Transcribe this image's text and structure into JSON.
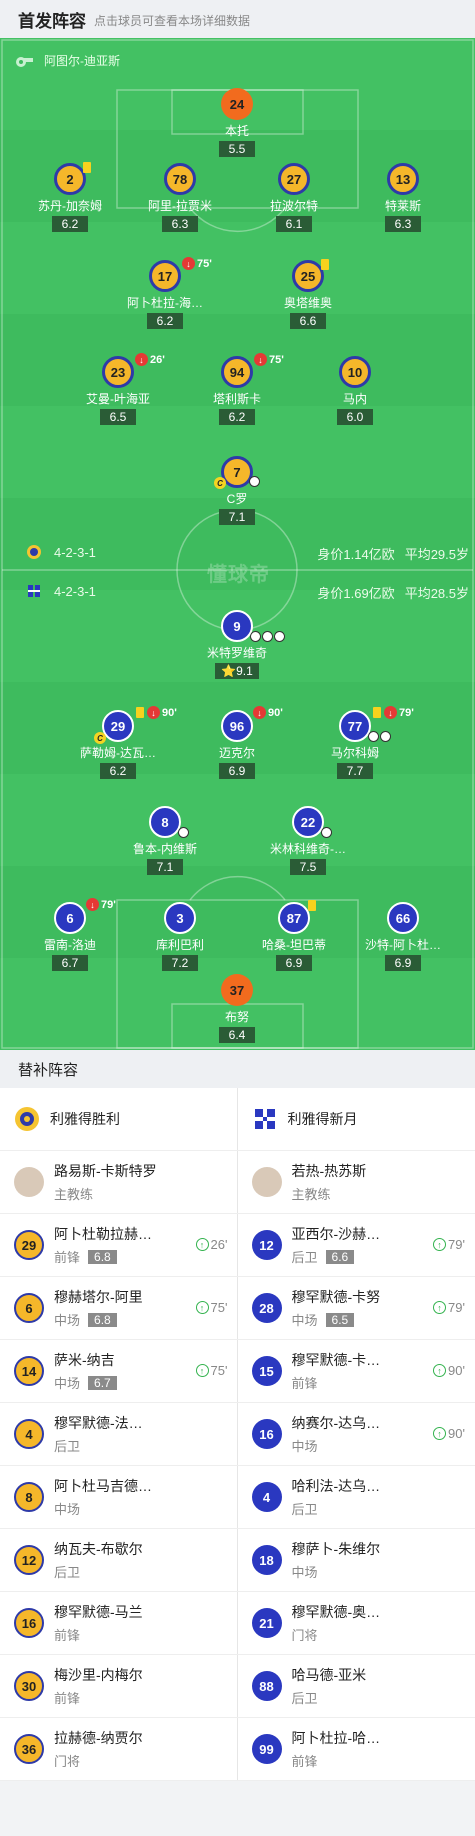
{
  "header": {
    "title": "首发阵容",
    "hint": "点击球员可查看本场详细数据"
  },
  "pitch": {
    "referee": "阿图尔-迪亚斯",
    "home": {
      "formation": "4-2-3-1",
      "value": "身价1.14亿欧",
      "age": "平均29.5岁"
    },
    "away": {
      "formation": "4-2-3-1",
      "value": "身价1.69亿欧",
      "age": "平均28.5岁"
    },
    "watermark": "懂球帝"
  },
  "home_players": [
    {
      "num": "24",
      "name": "本托",
      "rating": "5.5"
    },
    {
      "num": "2",
      "name": "苏丹-加奈姆",
      "rating": "6.2"
    },
    {
      "num": "78",
      "name": "阿里-拉贾米",
      "rating": "6.3"
    },
    {
      "num": "27",
      "name": "拉波尔特",
      "rating": "6.1"
    },
    {
      "num": "13",
      "name": "特莱斯",
      "rating": "6.3"
    },
    {
      "num": "17",
      "name": "阿卜杜拉-海…",
      "rating": "6.2",
      "sub": "75'"
    },
    {
      "num": "25",
      "name": "奥塔维奥",
      "rating": "6.6"
    },
    {
      "num": "23",
      "name": "艾曼-叶海亚",
      "rating": "6.5",
      "sub": "26'"
    },
    {
      "num": "94",
      "name": "塔利斯卡",
      "rating": "6.2",
      "sub": "75'"
    },
    {
      "num": "10",
      "name": "马内",
      "rating": "6.0"
    },
    {
      "num": "7",
      "name": "C罗",
      "rating": "7.1",
      "captain": "C"
    }
  ],
  "away_players": [
    {
      "num": "9",
      "name": "米特罗维奇",
      "rating": "9.1"
    },
    {
      "num": "29",
      "name": "萨勒姆-达瓦…",
      "rating": "6.2",
      "sub": "90'",
      "captain": "C"
    },
    {
      "num": "96",
      "name": "迈克尔",
      "rating": "6.9",
      "sub": "90'"
    },
    {
      "num": "77",
      "name": "马尔科姆",
      "rating": "7.7",
      "sub": "79'"
    },
    {
      "num": "8",
      "name": "鲁本-内维斯",
      "rating": "7.1"
    },
    {
      "num": "22",
      "name": "米林科维奇-…",
      "rating": "7.5"
    },
    {
      "num": "6",
      "name": "雷南-洛迪",
      "rating": "6.7",
      "sub": "79'"
    },
    {
      "num": "3",
      "name": "库利巴利",
      "rating": "7.2"
    },
    {
      "num": "87",
      "name": "哈桑-坦巴蒂",
      "rating": "6.9"
    },
    {
      "num": "66",
      "name": "沙特-阿卜杜…",
      "rating": "6.9"
    },
    {
      "num": "37",
      "name": "布努",
      "rating": "6.4"
    }
  ],
  "bench": {
    "title": "替补阵容",
    "home": {
      "team": "利雅得胜利",
      "coach": {
        "name": "路易斯-卡斯特罗",
        "role": "主教练"
      },
      "players": [
        {
          "num": "29",
          "name": "阿卜杜勒拉赫…",
          "pos": "前锋",
          "rating": "6.8",
          "time": "26'"
        },
        {
          "num": "6",
          "name": "穆赫塔尔-阿里",
          "pos": "中场",
          "rating": "6.8",
          "time": "75'"
        },
        {
          "num": "14",
          "name": "萨米-纳吉",
          "pos": "中场",
          "rating": "6.7",
          "time": "75'"
        },
        {
          "num": "4",
          "name": "穆罕默德-法…",
          "pos": "后卫"
        },
        {
          "num": "8",
          "name": "阿卜杜马吉德…",
          "pos": "中场"
        },
        {
          "num": "12",
          "name": "纳瓦夫-布歇尔",
          "pos": "后卫"
        },
        {
          "num": "16",
          "name": "穆罕默德-马兰",
          "pos": "前锋"
        },
        {
          "num": "30",
          "name": "梅沙里-内梅尔",
          "pos": "前锋"
        },
        {
          "num": "36",
          "name": "拉赫德-纳贾尔",
          "pos": "门将"
        }
      ]
    },
    "away": {
      "team": "利雅得新月",
      "coach": {
        "name": "若热-热苏斯",
        "role": "主教练"
      },
      "players": [
        {
          "num": "12",
          "name": "亚西尔-沙赫…",
          "pos": "后卫",
          "rating": "6.6",
          "time": "79'"
        },
        {
          "num": "28",
          "name": "穆罕默德-卡努",
          "pos": "中场",
          "rating": "6.5",
          "time": "79'"
        },
        {
          "num": "15",
          "name": "穆罕默德-卡…",
          "pos": "前锋",
          "time": "90'"
        },
        {
          "num": "16",
          "name": "纳赛尔-达乌…",
          "pos": "中场",
          "time": "90'"
        },
        {
          "num": "4",
          "name": "哈利法-达乌…",
          "pos": "后卫"
        },
        {
          "num": "18",
          "name": "穆萨卜-朱维尔",
          "pos": "中场"
        },
        {
          "num": "21",
          "name": "穆罕默德-奥…",
          "pos": "门将"
        },
        {
          "num": "88",
          "name": "哈马德-亚米",
          "pos": "后卫"
        },
        {
          "num": "99",
          "name": "阿卜杜拉-哈…",
          "pos": "前锋"
        }
      ]
    }
  },
  "colors": {
    "pitch": "#3ebb5e",
    "home_kit": "#f5b72a",
    "away_kit": "#2a38c0",
    "keeper": "#f26b1e"
  }
}
